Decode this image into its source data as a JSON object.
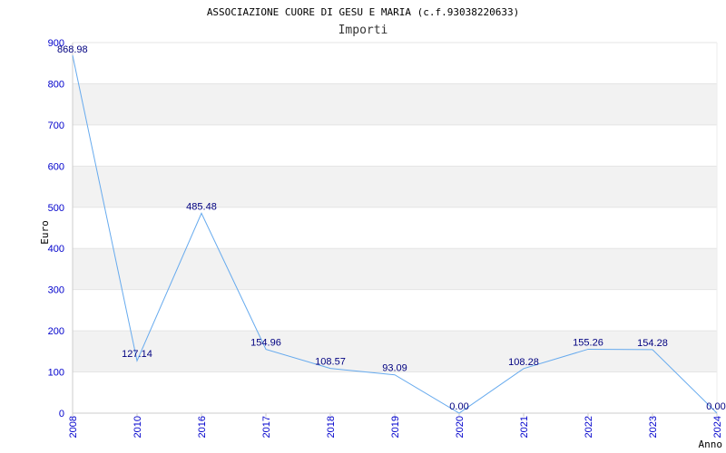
{
  "chart_data": {
    "type": "line",
    "title": "ASSOCIAZIONE CUORE DI GESU E MARIA (c.f.93038220633)",
    "subtitle": "Importi",
    "xlabel": "Anno",
    "ylabel": "Euro",
    "ylim": [
      0,
      900
    ],
    "yticks": [
      0,
      100,
      200,
      300,
      400,
      500,
      600,
      700,
      800,
      900
    ],
    "grid": "horizontal alternating bands",
    "categories": [
      "2008",
      "2010",
      "2016",
      "2017",
      "2018",
      "2019",
      "2020",
      "2021",
      "2022",
      "2023",
      "2024"
    ],
    "series": [
      {
        "values": [
          868.98,
          127.14,
          485.48,
          154.96,
          108.57,
          93.09,
          0.0,
          108.28,
          155.26,
          154.28,
          0.0
        ],
        "labels": [
          "868.98",
          "127.14",
          "485.48",
          "154.96",
          "108.57",
          "93.09",
          "0.00",
          "108.28",
          "155.26",
          "154.28",
          "0.00"
        ],
        "color": "#66aaee"
      }
    ],
    "colors": {
      "band": "#f2f2f2",
      "tick_text": "#0000cc",
      "data_label": "#000080",
      "axis": "#cccccc"
    }
  }
}
